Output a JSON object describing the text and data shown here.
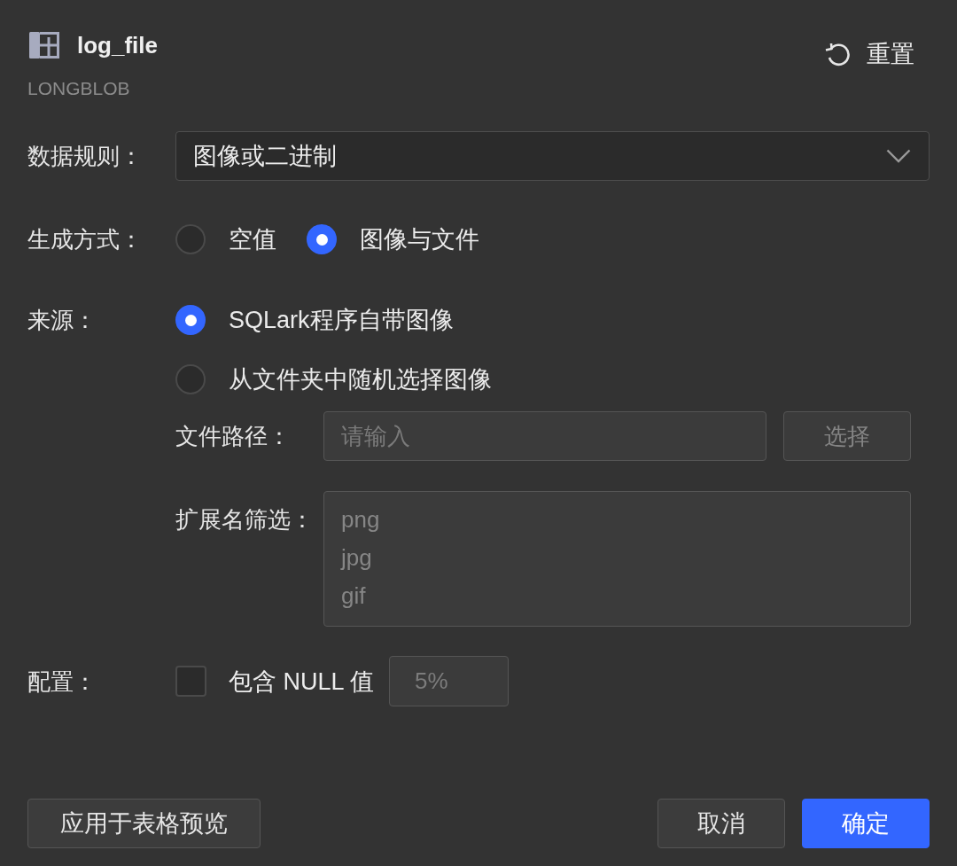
{
  "header": {
    "title": "log_file",
    "type": "LONGBLOB",
    "reset_button": "重置"
  },
  "data_rule": {
    "label": "数据规则：",
    "value": "图像或二进制"
  },
  "generation": {
    "label": "生成方式：",
    "options": [
      {
        "label": "空值",
        "selected": false
      },
      {
        "label": "图像与文件",
        "selected": true
      }
    ]
  },
  "source": {
    "label": "来源：",
    "options": [
      {
        "label": "SQLark程序自带图像",
        "selected": true
      },
      {
        "label": "从文件夹中随机选择图像",
        "selected": false
      }
    ],
    "file_path": {
      "label": "文件路径：",
      "placeholder": "请输入",
      "button": "选择",
      "disabled": true
    },
    "extension_filter": {
      "label": "扩展名筛选：",
      "value": "png\njpg\ngif",
      "disabled": true
    }
  },
  "config": {
    "label": "配置：",
    "include_null": {
      "label": "包含 NULL 值",
      "checked": false
    },
    "null_ratio": {
      "value": "5%",
      "disabled": true
    }
  },
  "footer": {
    "apply_button": "应用于表格预览",
    "buttons": [
      {
        "label": "取消",
        "primary": false
      },
      {
        "label": "确定",
        "primary": true
      }
    ]
  }
}
